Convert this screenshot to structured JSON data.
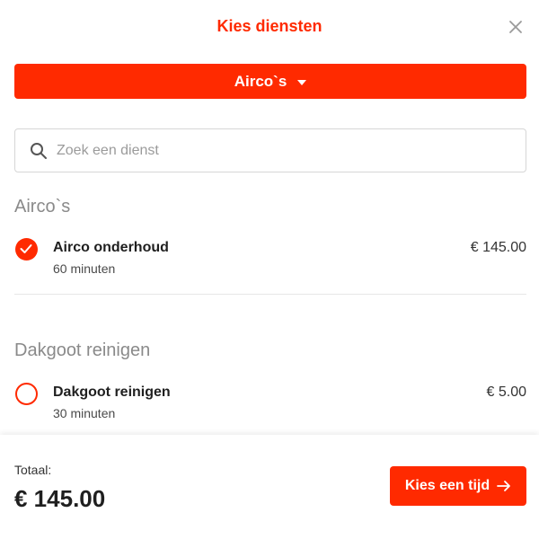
{
  "header": {
    "title": "Kies diensten",
    "close_icon": "close-icon"
  },
  "category_selector": {
    "label": "Airco`s",
    "icon": "caret-down-icon"
  },
  "search": {
    "placeholder": "Zoek een dienst",
    "value": "",
    "icon": "search-icon"
  },
  "sections": [
    {
      "title": "Airco`s",
      "services": [
        {
          "name": "Airco onderhoud",
          "duration": "60 minuten",
          "price": "€ 145.00",
          "selected": true
        }
      ]
    },
    {
      "title": "Dakgoot reinigen",
      "services": [
        {
          "name": "Dakgoot reinigen",
          "duration": "30 minuten",
          "price": "€ 5.00",
          "selected": false
        }
      ]
    }
  ],
  "footer": {
    "total_label": "Totaal:",
    "total_value": "€ 145.00",
    "cta_label": "Kies een tijd",
    "cta_icon": "arrow-right-icon"
  },
  "colors": {
    "accent": "#ff2a00",
    "muted_text": "#8a8a8a",
    "border": "#d6d6d6"
  }
}
